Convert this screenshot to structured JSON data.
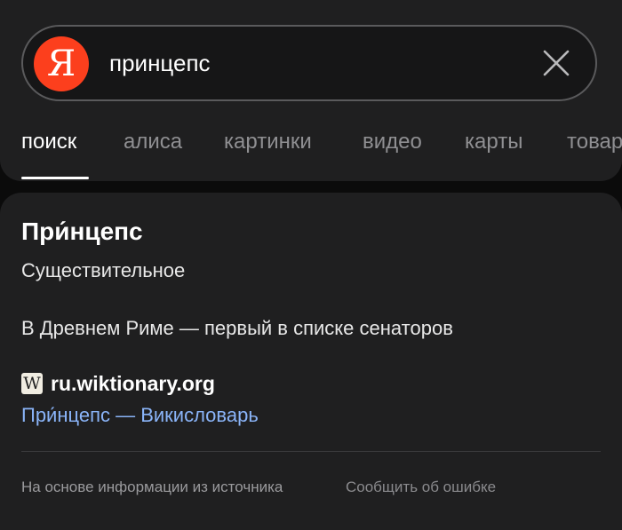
{
  "search": {
    "logo_letter": "Я",
    "query": "принцепс",
    "clear_icon": "close-icon"
  },
  "tabs": [
    {
      "label": "поиск",
      "active": true
    },
    {
      "label": "алиса",
      "active": false
    },
    {
      "label": "картинки",
      "active": false
    },
    {
      "label": "видео",
      "active": false
    },
    {
      "label": "карты",
      "active": false
    },
    {
      "label": "товары",
      "active": false
    }
  ],
  "result": {
    "title": "При́нцепс",
    "part_of_speech": "Существительное",
    "definition": "В Древнем Риме — первый в списке сенаторов",
    "source_icon": "wiktionary-icon",
    "source_icon_letter": "W",
    "source_domain": "ru.wiktionary.org",
    "source_link": "При́нцепс — Викисловарь"
  },
  "footer": {
    "note": "На основе информации из источника",
    "report": "Сообщить об ошибке"
  },
  "colors": {
    "brand": "#fc3f1d",
    "link": "#8ab4f8",
    "surface": "#1f1f20",
    "background": "#0b0b0b"
  }
}
